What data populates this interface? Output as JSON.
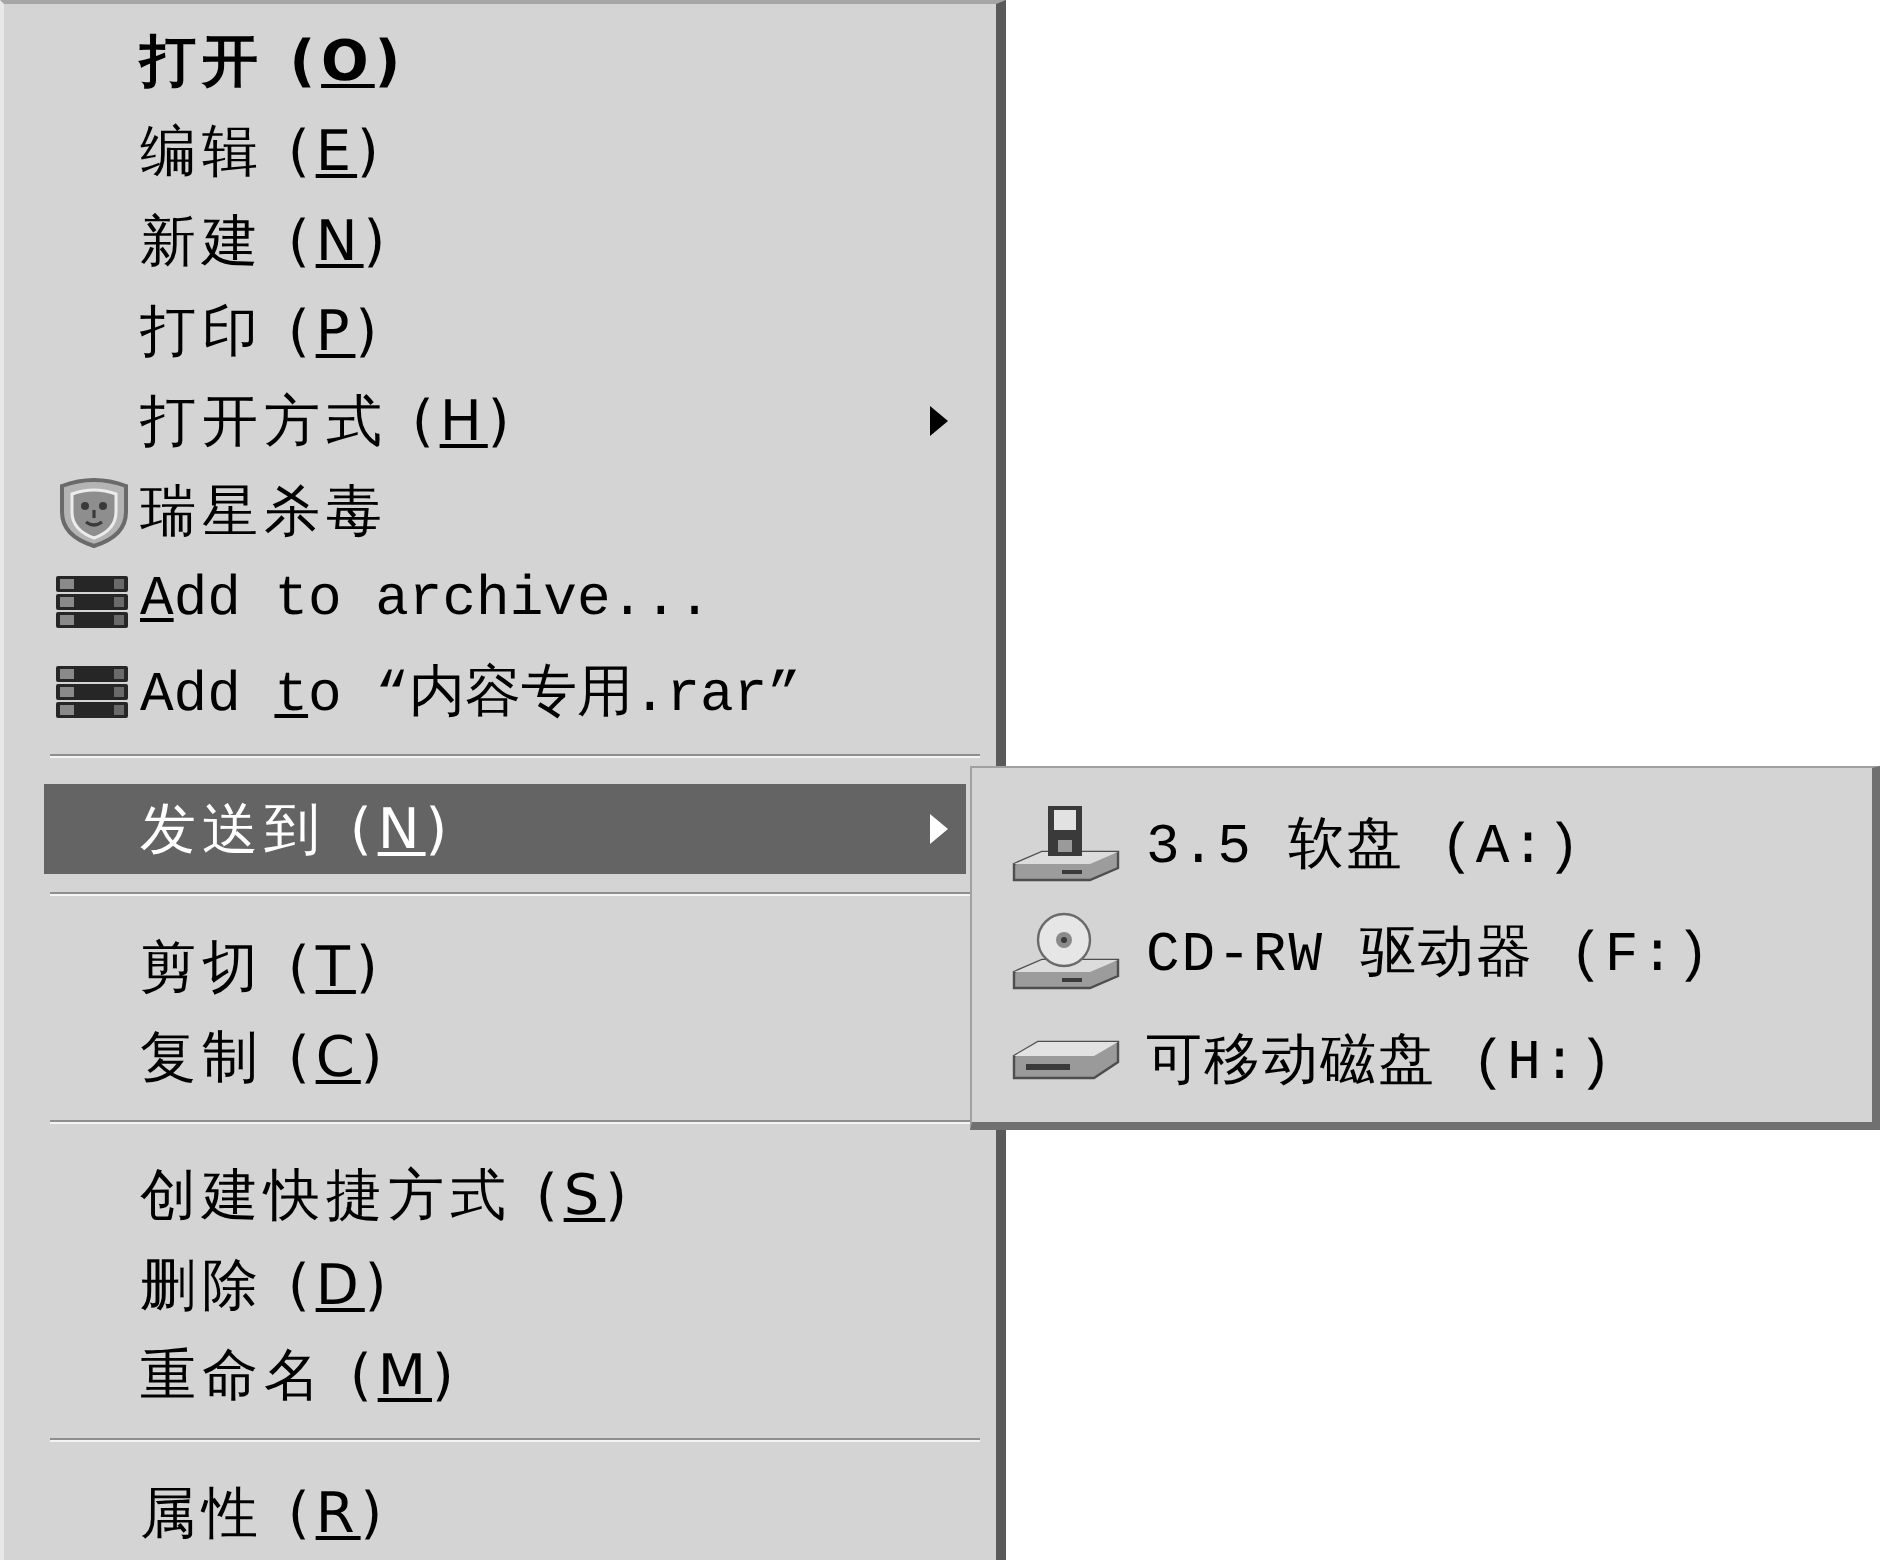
{
  "menu": {
    "items": [
      {
        "kind": "command",
        "label": "打开 (",
        "access_key": "O",
        "label_end": ")",
        "default": true,
        "selected": false,
        "submenu": false
      },
      {
        "kind": "command",
        "label": "编辑 (",
        "access_key": "E",
        "label_end": ")",
        "default": false,
        "selected": false,
        "submenu": false
      },
      {
        "kind": "command",
        "label": "新建 (",
        "access_key": "N",
        "label_end": ")",
        "default": false,
        "selected": false,
        "submenu": false
      },
      {
        "kind": "command",
        "label": "打印 (",
        "access_key": "P",
        "label_end": ")",
        "default": false,
        "selected": false,
        "submenu": false
      },
      {
        "kind": "command",
        "label": "打开方式 (",
        "access_key": "H",
        "label_end": ")",
        "default": false,
        "selected": false,
        "submenu": true
      },
      {
        "kind": "antivirus",
        "label": "瑞星杀毒",
        "default": false,
        "selected": false,
        "submenu": false
      },
      {
        "kind": "archive",
        "access_key": "A",
        "label_end": "dd to archive...",
        "default": false,
        "selected": false,
        "submenu": false
      },
      {
        "kind": "archive",
        "label": "Add ",
        "access_key": "t",
        "label_end": "o “内容专用.rar”",
        "default": false,
        "selected": false,
        "submenu": false
      },
      {
        "kind": "separator"
      },
      {
        "kind": "command",
        "label": "发送到 (",
        "access_key": "N",
        "label_end": ")",
        "default": false,
        "selected": true,
        "submenu": true,
        "submenu_items": [
          {
            "kind": "floppy",
            "label": "3.5 软盘 (A:)",
            "selected": false
          },
          {
            "kind": "cdrom",
            "label": "CD-RW 驱动器 (F:)",
            "selected": false
          },
          {
            "kind": "removable",
            "label": "可移动磁盘 (H:)",
            "selected": false
          }
        ]
      },
      {
        "kind": "separator"
      },
      {
        "kind": "command",
        "label": "剪切 (",
        "access_key": "T",
        "label_end": ")",
        "default": false,
        "selected": false,
        "submenu": false
      },
      {
        "kind": "command",
        "label": "复制 (",
        "access_key": "C",
        "label_end": ")",
        "default": false,
        "selected": false,
        "submenu": false
      },
      {
        "kind": "separator"
      },
      {
        "kind": "command",
        "label": "创建快捷方式 (",
        "access_key": "S",
        "label_end": ")",
        "default": false,
        "selected": false,
        "submenu": false
      },
      {
        "kind": "command",
        "label": "删除 (",
        "access_key": "D",
        "label_end": ")",
        "default": false,
        "selected": false,
        "submenu": false
      },
      {
        "kind": "command",
        "label": "重命名 (",
        "access_key": "M",
        "label_end": ")",
        "default": false,
        "selected": false,
        "submenu": false
      },
      {
        "kind": "separator"
      },
      {
        "kind": "command",
        "label": "属性 (",
        "access_key": "R",
        "label_end": ")",
        "default": false,
        "selected": false,
        "submenu": false
      }
    ]
  }
}
